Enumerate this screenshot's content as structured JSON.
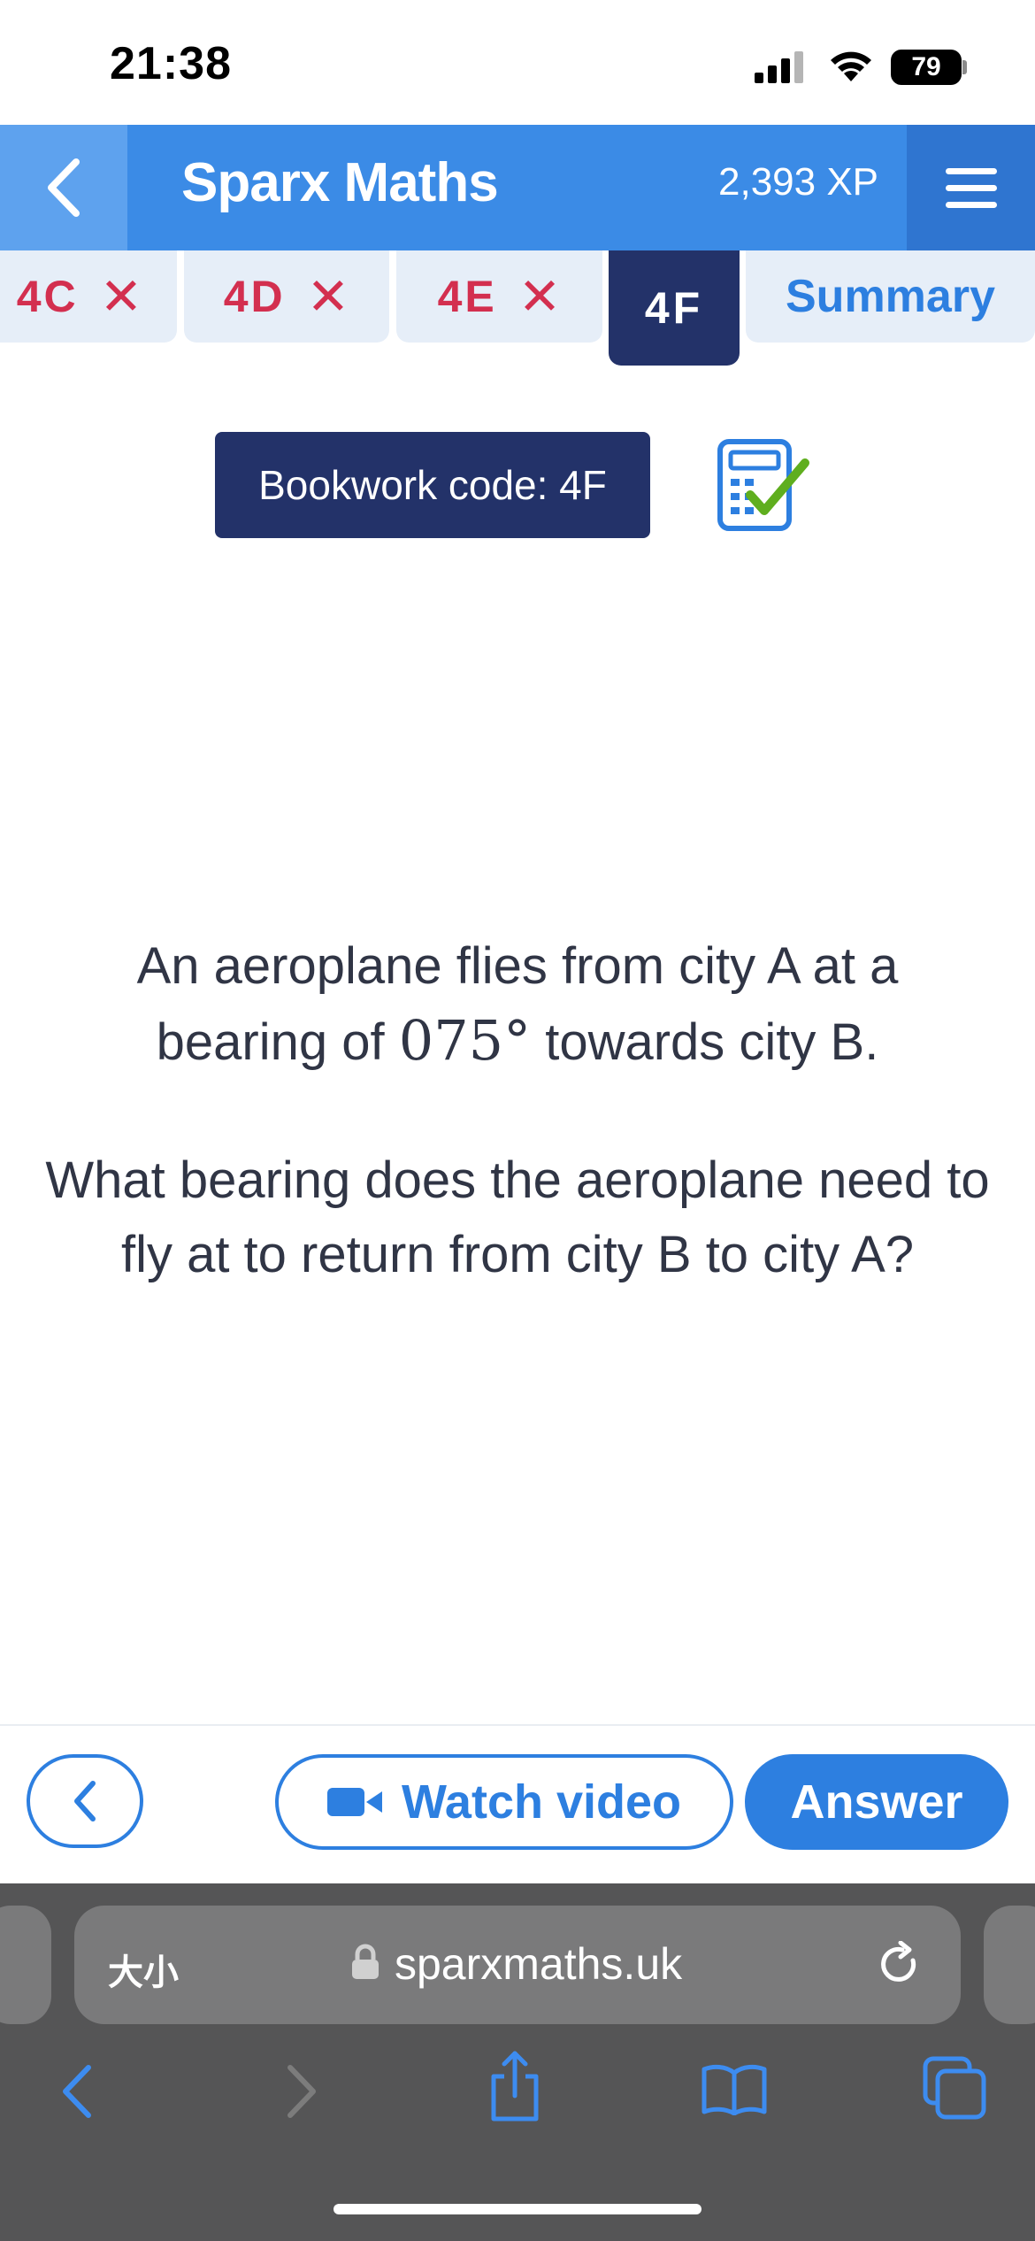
{
  "status_bar": {
    "time": "21:38",
    "battery": "79"
  },
  "header": {
    "title": "Sparx Maths",
    "xp": "2,393 XP",
    "accent": "#3b8be6"
  },
  "tabs": [
    {
      "label": "4C",
      "state": "incorrect"
    },
    {
      "label": "4D",
      "state": "incorrect"
    },
    {
      "label": "4E",
      "state": "incorrect"
    },
    {
      "label": "4F",
      "state": "active"
    },
    {
      "label": "Summary",
      "state": "summary"
    }
  ],
  "tab_status_symbol": "✕",
  "bookwork": {
    "label": "Bookwork code: 4F",
    "calculator_icon": "calculator-allowed-icon"
  },
  "question": {
    "line1_pre": "An aeroplane flies from city A at a",
    "line2_pre": "bearing of",
    "bearing": "075°",
    "line2_post": "towards city B.",
    "part2": "What bearing does the aeroplane need to fly at to return from city B to city A?"
  },
  "actions": {
    "watch_video": "Watch video",
    "answer": "Answer"
  },
  "browser": {
    "text_size_label": "大小",
    "url": "sparxmaths.uk"
  },
  "colors": {
    "incorrect": "#d32f4f",
    "active_tab": "#233269",
    "primary_button": "#2d7fe0"
  }
}
